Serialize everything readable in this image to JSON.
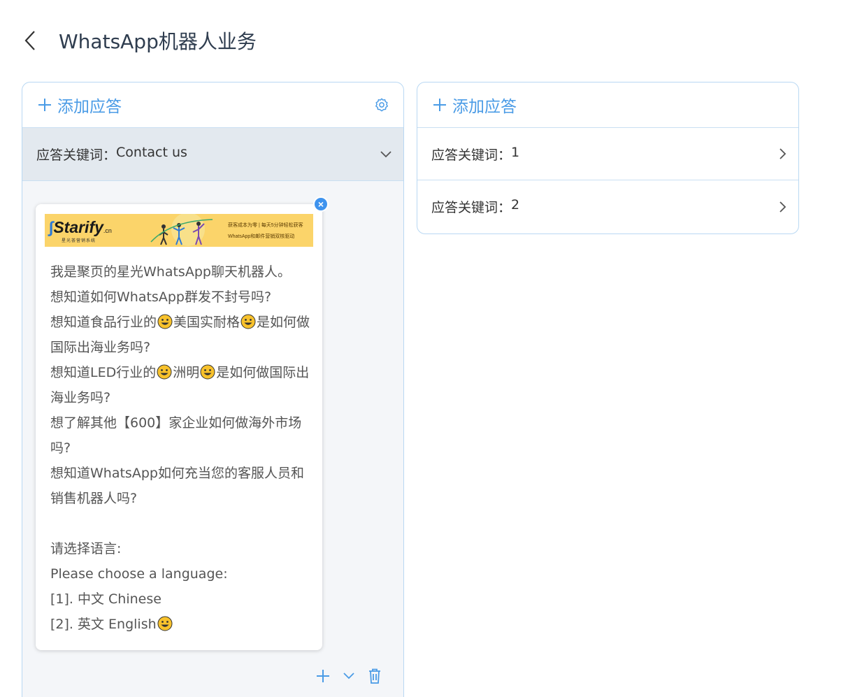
{
  "header": {
    "title": "WhatsApp机器人业务"
  },
  "left_panel": {
    "add_answer_label": "添加应答",
    "keyword_label": "应答关键词：",
    "keyword_value": "Contact us",
    "message": {
      "banner": {
        "logo": "Starify",
        "logo_suffix": ".cn",
        "subtitle": "星光荟营销系统",
        "tagline_1": "获客成本为零 | 每天5分钟轻松获客",
        "tagline_2": "WhatsApp和邮件营销双核驱动"
      },
      "lines": [
        {
          "t": "我是聚页的星光WhatsApp聊天机器人。"
        },
        {
          "t": "想知道如何WhatsApp群发不封号吗?"
        },
        {
          "a": "想知道食品行业的",
          "b": "美国实耐格",
          "c": "是如何做国际出海业务吗?"
        },
        {
          "a": "想知道LED行业的",
          "b": "洲明",
          "c": "是如何做国际出海业务吗?"
        },
        {
          "t": "想了解其他【600】家企业如何做海外市场吗?"
        },
        {
          "t": "想知道WhatsApp如何充当您的客服人员和销售机器人吗?"
        },
        {
          "t": ""
        },
        {
          "t": "请选择语言:"
        },
        {
          "t": "Please choose a language:"
        },
        {
          "t": "[1]. 中文 Chinese"
        },
        {
          "a": "[2]. 英文 English"
        }
      ]
    }
  },
  "right_panel": {
    "add_answer_label": "添加应答",
    "keywords": [
      {
        "label": "应答关键词：",
        "value": "1"
      },
      {
        "label": "应答关键词：",
        "value": "2"
      }
    ]
  },
  "colors": {
    "accent": "#4a9be6",
    "border": "#b9d8f3",
    "active_row": "#e3e9ef",
    "banner": "#fbd46a"
  },
  "icons": [
    "back-arrow-icon",
    "plus-icon",
    "gear-icon",
    "chevron-down-icon",
    "chevron-right-icon",
    "close-icon",
    "smiley-emoji-icon",
    "trash-icon",
    "camera-icon"
  ]
}
